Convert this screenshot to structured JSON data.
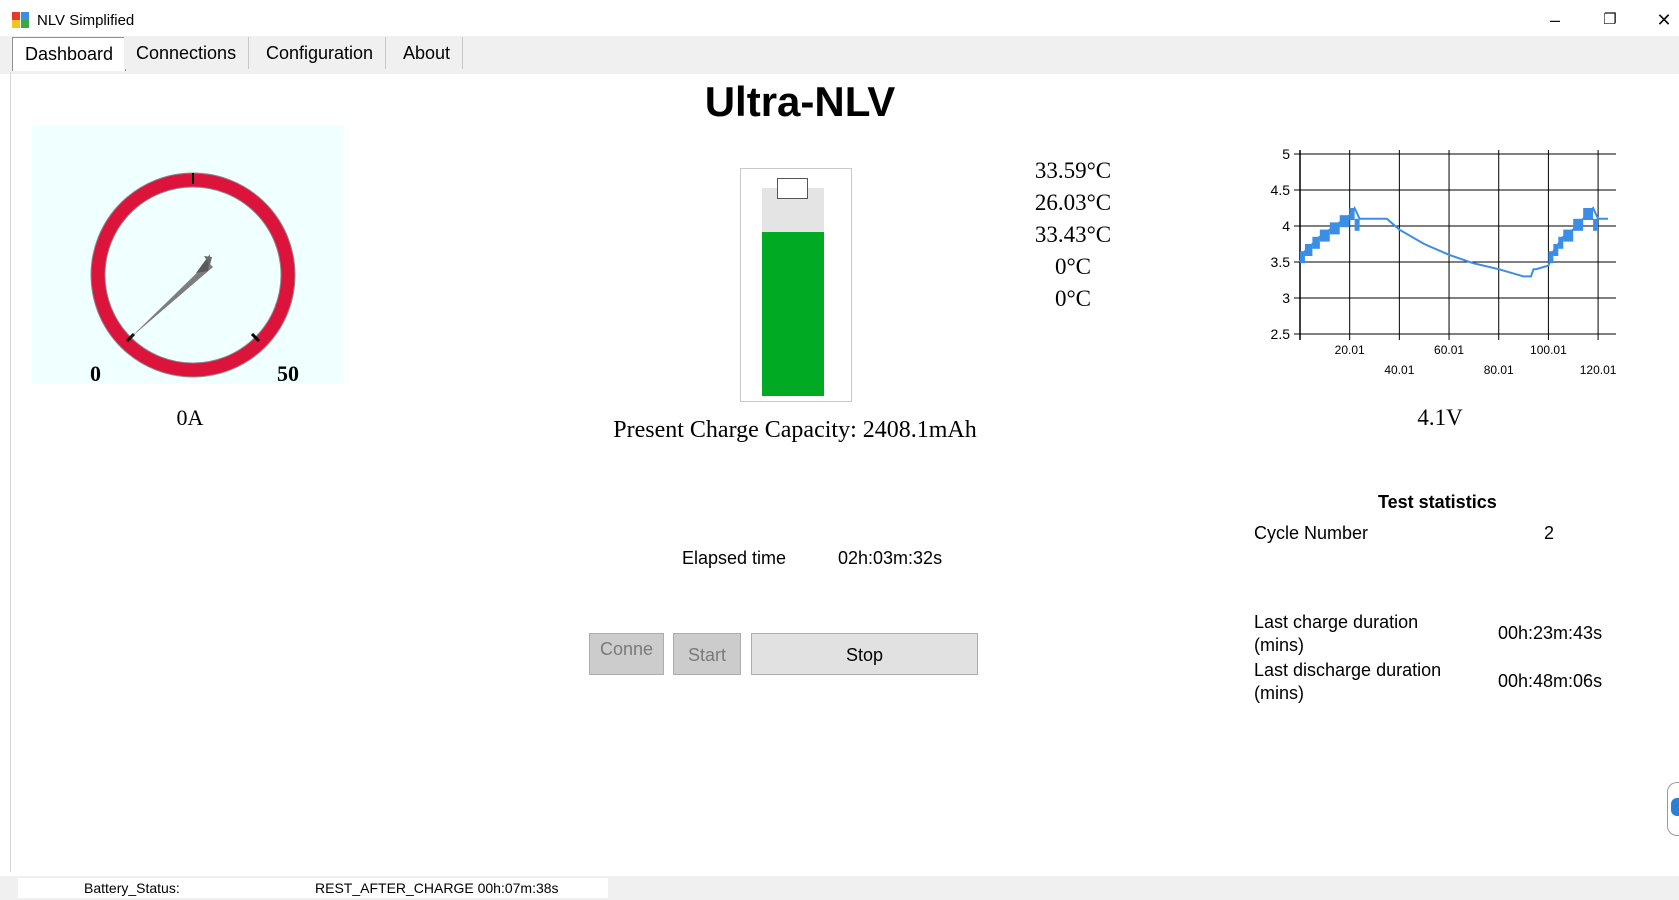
{
  "window": {
    "title": "NLV Simplified",
    "minimize_glyph": "–",
    "restore_glyph": "❐",
    "close_glyph": "✕"
  },
  "tabs": [
    {
      "label": "Dashboard",
      "active": true
    },
    {
      "label": "Connections",
      "active": false
    },
    {
      "label": "Configuration",
      "active": false
    },
    {
      "label": "About",
      "active": false
    }
  ],
  "heading": "Ultra-NLV",
  "gauge": {
    "min_label": "0",
    "max_label": "50",
    "min": 0,
    "max": 50,
    "value": 0,
    "reading": "0A",
    "ring_color": "#dc143c",
    "background": "#f0ffff"
  },
  "battery": {
    "fill_fraction": 0.79,
    "fill_color": "#00aa22",
    "capacity_text": "Present Charge Capacity: 2408.1mAh"
  },
  "temperatures": [
    "33.59°C",
    "26.03°C",
    "33.43°C",
    "0°C",
    "0°C"
  ],
  "chart_data": {
    "type": "line",
    "title": "",
    "xlabel": "",
    "ylabel": "",
    "y_ticks": [
      "5",
      "4.5",
      "4",
      "3.5",
      "3",
      "2.5"
    ],
    "x_ticks_top": [
      "20.01",
      "60.01",
      "100.01"
    ],
    "x_ticks_bottom": [
      "40.01",
      "80.01",
      "120.01"
    ],
    "ylim": [
      2.5,
      5
    ],
    "xlim": [
      0.01,
      124
    ],
    "grid": true,
    "color": "#3a8ee6",
    "x": [
      0.01,
      2,
      5,
      8,
      12,
      16,
      20,
      22,
      24,
      26,
      30,
      35,
      40,
      50,
      60,
      70,
      80,
      90,
      93,
      94,
      95,
      100,
      102,
      104,
      106,
      110,
      114,
      118,
      120,
      124
    ],
    "y": [
      3.5,
      3.65,
      3.75,
      3.85,
      3.95,
      4.05,
      4.15,
      4.25,
      4.1,
      4.1,
      4.1,
      4.1,
      3.95,
      3.75,
      3.6,
      3.48,
      3.4,
      3.3,
      3.3,
      3.4,
      3.4,
      3.45,
      3.65,
      3.75,
      3.85,
      3.95,
      4.1,
      4.25,
      4.1,
      4.1
    ],
    "charge_spans": [
      [
        0.01,
        24
      ],
      [
        100,
        120
      ]
    ]
  },
  "voltage_reading": "4.1V",
  "elapsed": {
    "label": "Elapsed time",
    "value": "02h:03m:32s"
  },
  "buttons": {
    "connect": "Conne",
    "start": "Start",
    "stop": "Stop"
  },
  "stats": {
    "title": "Test statistics",
    "cycle_label": "Cycle Number",
    "cycle_value": "2",
    "last_charge_label_1": "Last charge duration",
    "last_charge_label_2": "(mins)",
    "last_charge_value": "00h:23m:43s",
    "last_discharge_label_1": "Last discharge duration",
    "last_discharge_label_2": "(mins)",
    "last_discharge_value": "00h:48m:06s"
  },
  "status": {
    "label": "Battery_Status:",
    "value": "REST_AFTER_CHARGE 00h:07m:38s"
  }
}
